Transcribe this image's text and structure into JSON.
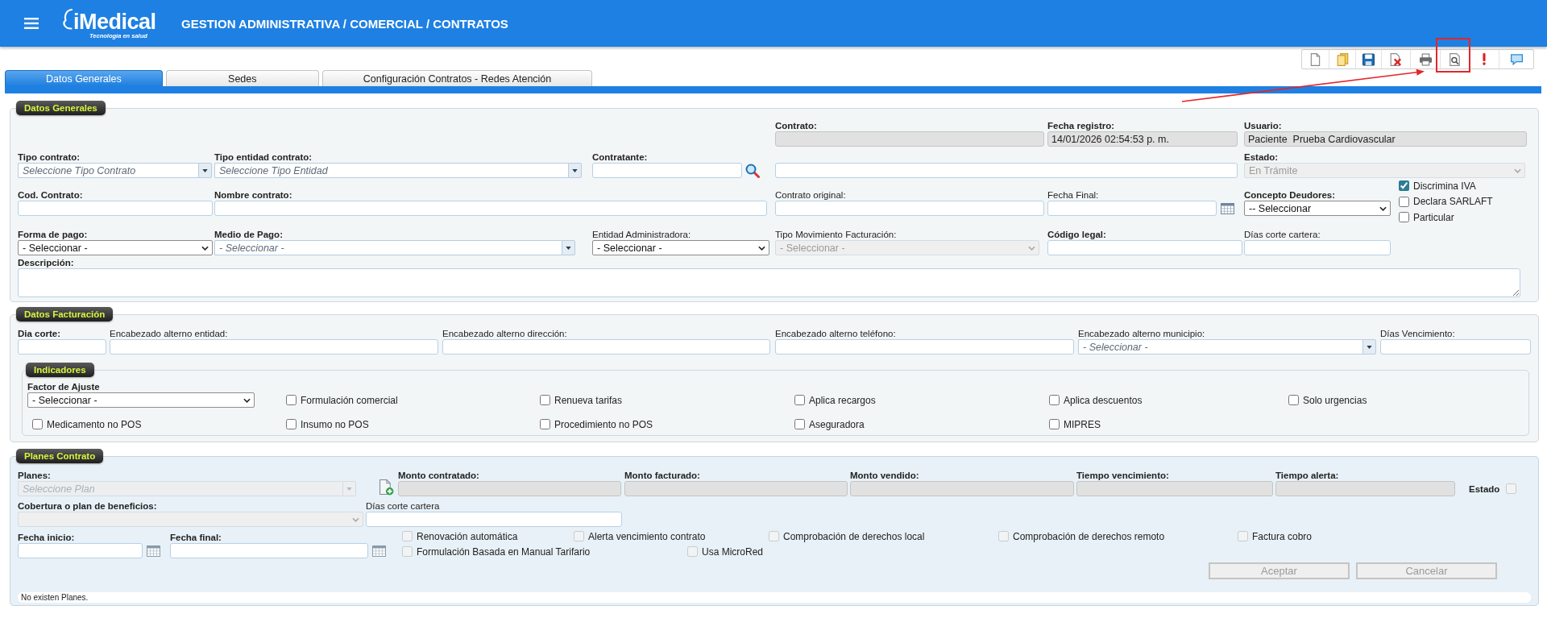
{
  "header": {
    "logo": "iMedical",
    "logo_tagline": "Tecnología en salud",
    "title": "GESTION ADMINISTRATIVA / COMERCIAL / CONTRATOS"
  },
  "toolbar": {
    "buttons": [
      {
        "kind": "new",
        "highlighted": false
      },
      {
        "kind": "open",
        "highlighted": false
      },
      {
        "kind": "save",
        "highlighted": false
      },
      {
        "kind": "delete",
        "highlighted": false
      },
      {
        "kind": "print",
        "highlighted": false
      },
      {
        "kind": "preview",
        "highlighted": true
      },
      {
        "kind": "alert",
        "highlighted": false
      },
      {
        "kind": "comment",
        "highlighted": false
      }
    ],
    "annotation_arrow": true
  },
  "tabs": [
    {
      "label": "Datos Generales",
      "selected": true
    },
    {
      "label": "Sedes",
      "selected": false
    },
    {
      "label": "Configuración Contratos - Redes Atención",
      "selected": false
    }
  ],
  "datos_generales": {
    "legend": "Datos Generales",
    "fields": [
      {
        "kind": "text",
        "label": "Contrato:",
        "disabled": true
      },
      {
        "kind": "text",
        "label": "Fecha registro:",
        "value": "14/01/2026 02:54:53 p. m.",
        "disabled": true
      },
      {
        "kind": "text",
        "label": "Usuario:",
        "value": "Paciente  Prueba Cardiovascular",
        "disabled": true
      },
      {
        "kind": "combo",
        "label": "Tipo contrato:",
        "placeholder": "Seleccione Tipo Contrato",
        "disabled": false
      },
      {
        "kind": "combo",
        "label": "Tipo entidad contrato:",
        "placeholder": "Seleccione Tipo Entidad",
        "disabled": false
      },
      {
        "kind": "search",
        "label": "Contratante:",
        "disabled": false
      },
      {
        "kind": "text",
        "disabled": false
      },
      {
        "kind": "select",
        "label": "Estado:",
        "value": "En Trámite",
        "disabled": true
      },
      {
        "kind": "text",
        "label": "Cod. Contrato:",
        "disabled": false
      },
      {
        "kind": "text",
        "label": "Nombre contrato:",
        "disabled": false
      },
      {
        "kind": "text",
        "label": "Contrato original:",
        "disabled": false
      },
      {
        "kind": "date",
        "label": "Fecha Final:",
        "disabled": false
      },
      {
        "kind": "select",
        "label": "Concepto Deudores:",
        "value": "-- Seleccionar",
        "disabled": false
      },
      {
        "kind": "select",
        "label": "Forma de pago:",
        "value": "- Seleccionar -",
        "disabled": false
      },
      {
        "kind": "combo",
        "label": "Medio de Pago:",
        "placeholder": "- Seleccionar -",
        "disabled": false
      },
      {
        "kind": "select",
        "label": "Entidad Administradora:",
        "value": "- Seleccionar -",
        "disabled": false
      },
      {
        "kind": "select",
        "label": "Tipo Movimiento Facturación:",
        "value": "- Seleccionar -",
        "disabled": true
      },
      {
        "kind": "text",
        "label": "Código legal:",
        "disabled": false
      },
      {
        "kind": "text",
        "label": "Días corte cartera:",
        "disabled": false
      },
      {
        "kind": "textarea",
        "label": "Descripción:",
        "disabled": false
      }
    ],
    "checkboxes": [
      {
        "label": "Discrimina IVA",
        "checked": true
      },
      {
        "label": "Declara SARLAFT",
        "checked": false
      },
      {
        "label": "Particular",
        "checked": false
      }
    ]
  },
  "datos_facturacion": {
    "legend": "Datos Facturación",
    "fields": [
      {
        "kind": "text",
        "label": "Dia corte:",
        "disabled": false
      },
      {
        "kind": "text",
        "label": "Encabezado alterno entidad:",
        "disabled": false
      },
      {
        "kind": "text",
        "label": "Encabezado alterno dirección:",
        "disabled": false
      },
      {
        "kind": "text",
        "label": "Encabezado alterno teléfono:",
        "disabled": false
      },
      {
        "kind": "combo",
        "label": "Encabezado alterno municipio:",
        "placeholder": "- Seleccionar -",
        "disabled": false
      },
      {
        "kind": "text",
        "label": "Días Vencimiento:",
        "disabled": false
      }
    ],
    "indicadores": {
      "legend": "Indicadores",
      "factor_ajuste": {
        "label": "Factor de Ajuste",
        "value": "- Seleccionar -"
      },
      "checkboxes": [
        {
          "label": "Formulación comercial",
          "checked": false
        },
        {
          "label": "Renueva tarifas",
          "checked": false
        },
        {
          "label": "Aplica recargos",
          "checked": false
        },
        {
          "label": "Aplica descuentos",
          "checked": false
        },
        {
          "label": "Solo urgencias",
          "checked": false
        },
        {
          "label": "Medicamento no POS",
          "checked": false
        },
        {
          "label": "Insumo no POS",
          "checked": false
        },
        {
          "label": "Procedimiento no POS",
          "checked": false
        },
        {
          "label": "Aseguradora",
          "checked": false
        },
        {
          "label": "MIPRES",
          "checked": false
        }
      ]
    }
  },
  "planes_contrato": {
    "legend": "Planes Contrato",
    "fields": [
      {
        "kind": "combo",
        "label": "Planes:",
        "placeholder": "Seleccione Plan",
        "disabled": true
      },
      {
        "kind": "text",
        "label": "Monto contratado:",
        "disabled": true
      },
      {
        "kind": "text",
        "label": "Monto facturado:",
        "disabled": true
      },
      {
        "kind": "text",
        "label": "Monto vendido:",
        "disabled": true
      },
      {
        "kind": "text",
        "label": "Tiempo vencimiento:",
        "disabled": true
      },
      {
        "kind": "text",
        "label": "Tiempo alerta:",
        "disabled": true
      },
      {
        "kind": "select",
        "label": "Cobertura o plan de beneficios:",
        "disabled": true
      },
      {
        "kind": "text",
        "label": "Días corte cartera",
        "disabled": false
      },
      {
        "kind": "date",
        "label": "Fecha inicio:",
        "disabled": false
      },
      {
        "kind": "date",
        "label": "Fecha final:",
        "disabled": false
      }
    ],
    "estado": {
      "label": "Estado",
      "checked": false,
      "disabled": true
    },
    "checkboxes": [
      {
        "label": "Renovación automática",
        "checked": false,
        "disabled": true
      },
      {
        "label": "Alerta vencimiento contrato",
        "checked": false,
        "disabled": true
      },
      {
        "label": "Comprobación de derechos local",
        "checked": false,
        "disabled": true
      },
      {
        "label": "Comprobación de derechos remoto",
        "checked": false,
        "disabled": true
      },
      {
        "label": "Factura cobro",
        "checked": false,
        "disabled": true
      },
      {
        "label": "Formulación Basada en Manual Tarifario",
        "checked": false,
        "disabled": true
      },
      {
        "label": "Usa MicroRed",
        "checked": false,
        "disabled": true
      }
    ],
    "buttons": [
      {
        "label": "Aceptar",
        "disabled": true
      },
      {
        "label": "Cancelar",
        "disabled": true
      }
    ],
    "empty_message": "No existen Planes."
  }
}
